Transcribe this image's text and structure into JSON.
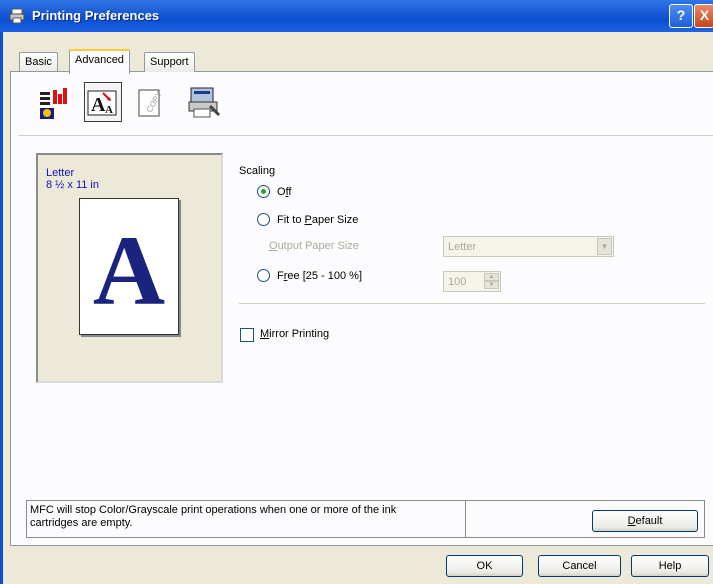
{
  "window": {
    "title": "Printing Preferences",
    "help_symbol": "?",
    "close_symbol": "X"
  },
  "tabs": [
    {
      "label": "Basic",
      "active": false
    },
    {
      "label": "Advanced",
      "active": true
    },
    {
      "label": "Support",
      "active": false
    }
  ],
  "toolbar": {
    "icons": [
      "print-quality-icon",
      "scaling-icon",
      "watermark-icon",
      "device-options-icon"
    ],
    "selected": "scaling-icon"
  },
  "preview": {
    "paper": "Letter",
    "size": "8 ½ x 11 in",
    "glyph": "A"
  },
  "scaling": {
    "label": "Scaling",
    "options": [
      {
        "pre": "O",
        "mn": "f",
        "post": "f",
        "selected": true
      },
      {
        "pre": "Fit to ",
        "mn": "P",
        "post": "aper Size",
        "selected": false
      },
      {
        "pre": "F",
        "mn": "r",
        "post": "ee [25 - 100 %]",
        "selected": false
      }
    ],
    "output_paper_size": {
      "mn": "O",
      "rest": "utput Paper Size",
      "value": "Letter",
      "enabled": false
    },
    "free_value": "100"
  },
  "mirror_printing": {
    "mn": "M",
    "rest": "irror Printing",
    "checked": false
  },
  "status": {
    "line1": "MFC will stop Color/Grayscale print operations when one or more of the ink",
    "line2": "cartridges are empty."
  },
  "buttons": {
    "default": {
      "mn": "D",
      "rest": "efault"
    },
    "ok": "OK",
    "cancel": "Cancel",
    "help": "Help"
  },
  "colors": {
    "titlebar": "#0b4fd0",
    "dialog": "#ece9d8",
    "tab_highlight": "#ffc83c",
    "preview_text": "#1010c0",
    "letter_fill": "#1a237e"
  }
}
